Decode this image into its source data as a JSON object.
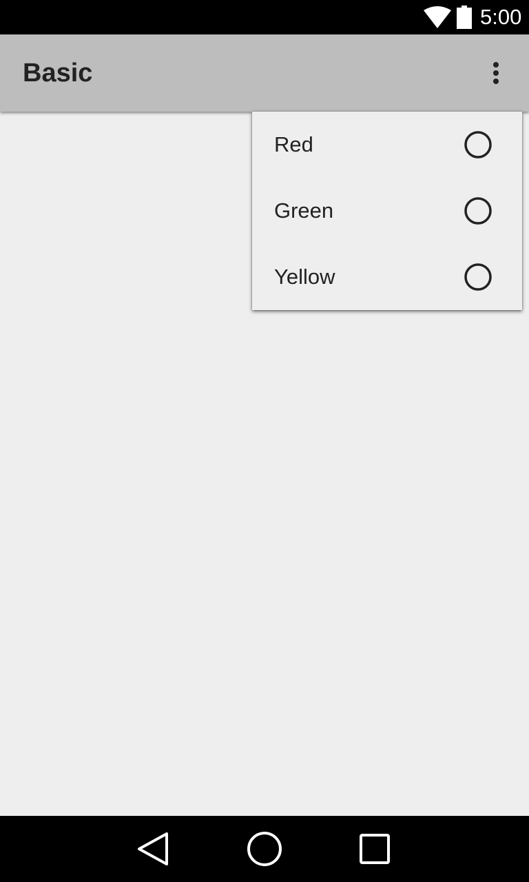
{
  "status_bar": {
    "time": "5:00",
    "icons": [
      "wifi-icon",
      "battery-icon"
    ]
  },
  "app_bar": {
    "title": "Basic",
    "overflow_icon": "more-vert-icon"
  },
  "popup_menu": {
    "items": [
      {
        "label": "Red",
        "checked": false
      },
      {
        "label": "Green",
        "checked": false
      },
      {
        "label": "Yellow",
        "checked": false
      }
    ]
  },
  "nav_bar": {
    "buttons": [
      "back-icon",
      "home-icon",
      "recents-icon"
    ]
  },
  "colors": {
    "app_bar": "#bdbdbd",
    "background": "#eeeeee",
    "system_bars": "#000000",
    "text": "#222222"
  }
}
